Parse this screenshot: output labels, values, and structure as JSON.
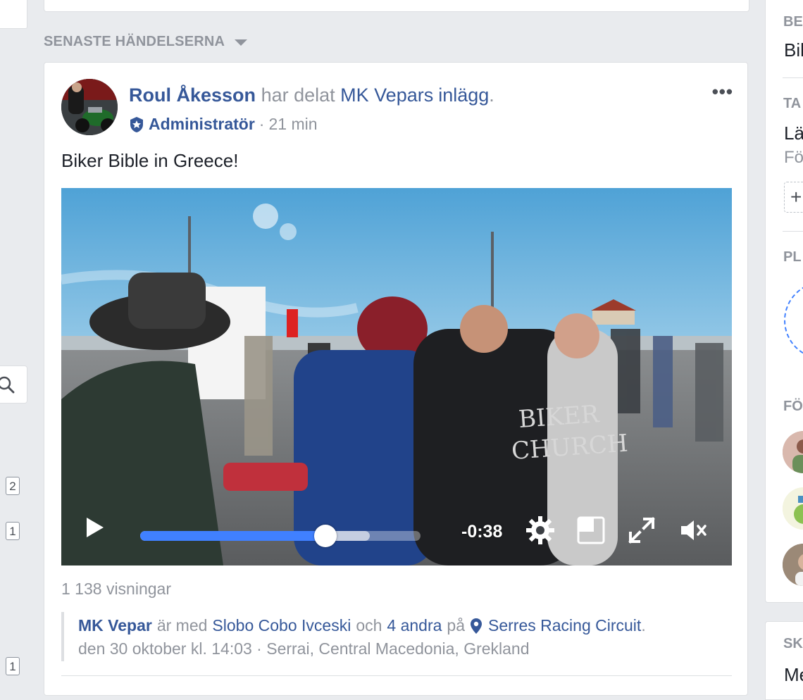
{
  "feed": {
    "section_title": "SENASTE HÄNDELSERNA"
  },
  "left_rail": {
    "counts": [
      "2",
      "1",
      "1"
    ]
  },
  "post": {
    "author": "Roul Åkesson",
    "action_prefix": "har delat",
    "shared_from": "MK Vepars",
    "shared_object": "inlägg",
    "period": ".",
    "role": "Administratör",
    "separator": "·",
    "time_ago": "21 min",
    "text": "Biker Bible in Greece!",
    "views": "1 138 visningar",
    "video": {
      "remaining_time": "-0:38",
      "played_fraction": 0.66,
      "buffered_fraction": 0.82
    },
    "checkin": {
      "page": "MK Vepar",
      "with_text": "är med",
      "tagged_person": "Slobo Cobo Ivceski",
      "and_text": "och",
      "others": "4 andra",
      "at_text": "på",
      "place": "Serres Racing Circuit",
      "period": ".",
      "date_location": "den 30 oktober kl. 14:03 · Serrai, Central Macedonia, Grekland"
    }
  },
  "right_rail": {
    "head1": "BES",
    "text1": "Bik",
    "head2": "TA",
    "text2": "Lä",
    "muted2": "Fö",
    "plus": "+",
    "head3": "PL",
    "head4": "FÖ",
    "head5": "SK",
    "text5": "Me"
  },
  "colors": {
    "link": "#365899",
    "muted": "#90949c",
    "progress": "#4080ff",
    "page_bg": "#e9ebee"
  }
}
